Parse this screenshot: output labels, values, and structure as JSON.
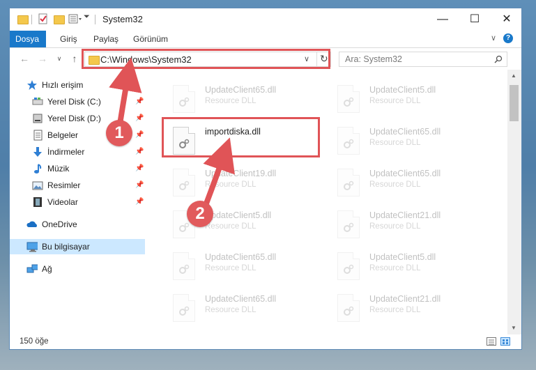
{
  "window": {
    "title": "System32",
    "minimize": "—",
    "maximize": "☐",
    "close": "✕"
  },
  "ribbon": {
    "tabs": [
      {
        "label": "Dosya",
        "active": true
      },
      {
        "label": "Giriş"
      },
      {
        "label": "Paylaş"
      },
      {
        "label": "Görünüm"
      }
    ],
    "collapse_icon": "chevron-down-icon",
    "help_icon": "help-icon"
  },
  "nav": {
    "back_icon": "arrow-left-icon",
    "forward_icon": "arrow-right-icon",
    "recent_icon": "chevron-down-icon",
    "up_icon": "arrow-up-icon",
    "address": "C:\\Windows\\System32",
    "refresh_icon": "refresh-icon",
    "search_placeholder": "Ara: System32"
  },
  "sidebar": {
    "items": [
      {
        "label": "Hızlı erişim",
        "icon": "star-icon",
        "pinned": false
      },
      {
        "label": "Yerel Disk (C:)",
        "icon": "drive-icon",
        "pinned": true
      },
      {
        "label": "Yerel Disk (D:)",
        "icon": "drive-icon",
        "pinned": true
      },
      {
        "label": "Belgeler",
        "icon": "documents-icon",
        "pinned": true
      },
      {
        "label": "İndirmeler",
        "icon": "download-icon",
        "pinned": true
      },
      {
        "label": "Müzik",
        "icon": "music-icon",
        "pinned": true
      },
      {
        "label": "Resimler",
        "icon": "pictures-icon",
        "pinned": true
      },
      {
        "label": "Videolar",
        "icon": "video-icon",
        "pinned": true
      },
      {
        "label": "OneDrive",
        "icon": "cloud-icon",
        "pinned": false
      },
      {
        "label": "Bu bilgisayar",
        "icon": "computer-icon",
        "pinned": false,
        "selected": true
      },
      {
        "label": "Ağ",
        "icon": "network-icon",
        "pinned": false
      }
    ]
  },
  "files": [
    {
      "name": "UpdateClient65.dll",
      "type": "Resource DLL"
    },
    {
      "name": "UpdateClient5.dll",
      "type": "Resource DLL"
    },
    {
      "name": "importdiska.dll",
      "type": "",
      "highlight": true
    },
    {
      "name": "UpdateClient65.dll",
      "type": "Resource DLL"
    },
    {
      "name": "UpdateClient19.dll",
      "type": "Resource DLL"
    },
    {
      "name": "UpdateClient65.dll",
      "type": "Resource DLL"
    },
    {
      "name": "UpdateClient5.dll",
      "type": "Resource DLL"
    },
    {
      "name": "UpdateClient21.dll",
      "type": "Resource DLL"
    },
    {
      "name": "UpdateClient65.dll",
      "type": "Resource DLL"
    },
    {
      "name": "UpdateClient5.dll",
      "type": "Resource DLL"
    },
    {
      "name": "UpdateClient65.dll",
      "type": "Resource DLL"
    },
    {
      "name": "UpdateClient21.dll",
      "type": "Resource DLL"
    }
  ],
  "status": {
    "count": "150 öğe"
  },
  "annotations": {
    "badge1": "1",
    "badge2": "2",
    "color": "#e05457"
  }
}
